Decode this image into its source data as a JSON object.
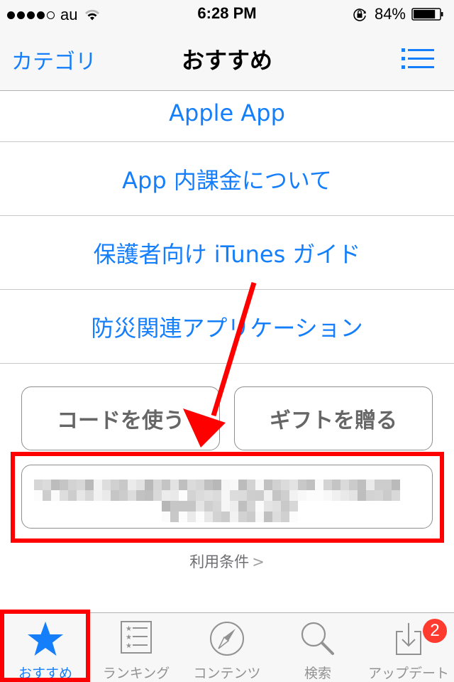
{
  "status_bar": {
    "signal_bars_filled": 4,
    "signal_bars_total": 5,
    "carrier": "au",
    "time": "6:28 PM",
    "battery_percent_label": "84%",
    "battery_level": 0.84
  },
  "nav_bar": {
    "back_label": "カテゴリ",
    "title": "おすすめ",
    "right_icon": "list-icon"
  },
  "links": [
    {
      "label": "Apple App"
    },
    {
      "label": "App 内課金について"
    },
    {
      "label": "保護者向け iTunes ガイド"
    },
    {
      "label": "防災関連アプリケーション"
    }
  ],
  "buttons": {
    "redeem": "コードを使う",
    "gift": "ギフトを贈る"
  },
  "account_box": {
    "content": "(pixelated / redacted Apple ID)"
  },
  "terms": {
    "label": "利用条件",
    "chevron": ">"
  },
  "tab_bar": {
    "tabs": [
      {
        "label": "おすすめ",
        "icon": "star-icon",
        "active": true
      },
      {
        "label": "ランキング",
        "icon": "ranking-list-icon",
        "active": false
      },
      {
        "label": "コンテンツ",
        "icon": "compass-icon",
        "active": false
      },
      {
        "label": "検索",
        "icon": "search-icon",
        "active": false
      },
      {
        "label": "アップデート",
        "icon": "updates-icon",
        "active": false,
        "badge": "2"
      }
    ]
  },
  "colors": {
    "accent": "#147efb",
    "annotation": "#ff0000",
    "badge": "#ff3b30",
    "inactive": "#929292"
  }
}
